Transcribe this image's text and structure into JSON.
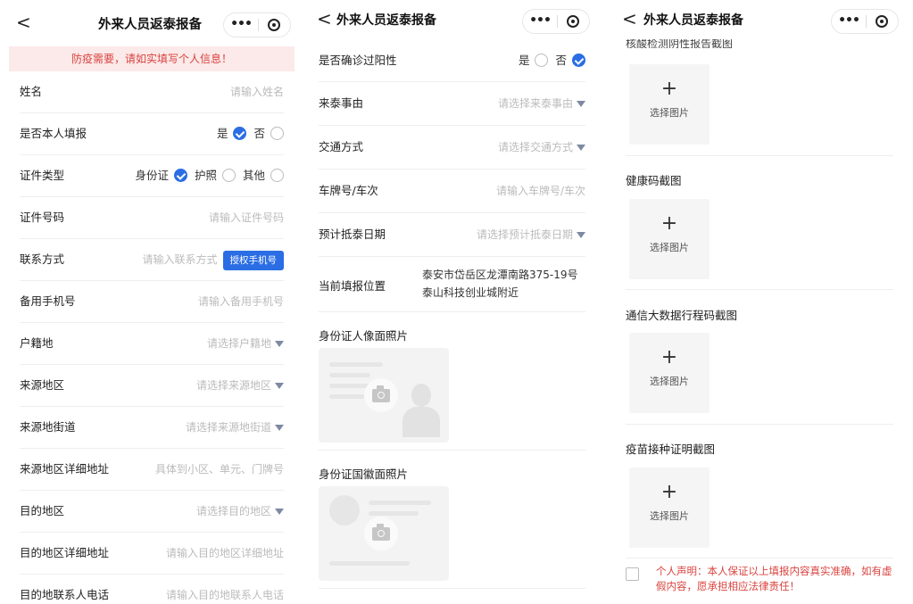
{
  "screen1": {
    "nav": {
      "back": "<",
      "title": "外来人员返泰报备",
      "dots": "•••"
    },
    "notice": "防疫需要，请如实填写个人信息！",
    "name": {
      "label": "姓名",
      "placeholder": "请输入姓名"
    },
    "self": {
      "label": "是否本人填报",
      "yes": "是",
      "no": "否",
      "selected": "yes"
    },
    "idtype": {
      "label": "证件类型",
      "opt1": "身份证",
      "opt2": "护照",
      "opt3": "其他",
      "selected": "身份证"
    },
    "idno": {
      "label": "证件号码",
      "placeholder": "请输入证件号码"
    },
    "contact": {
      "label": "联系方式",
      "placeholder": "请输入联系方式",
      "button": "授权手机号"
    },
    "backup": {
      "label": "备用手机号",
      "placeholder": "请输入备用手机号"
    },
    "huji": {
      "label": "户籍地",
      "placeholder": "请选择户籍地"
    },
    "origin": {
      "label": "来源地区",
      "placeholder": "请选择来源地区"
    },
    "street": {
      "label": "来源地街道",
      "placeholder": "请选择来源地街道"
    },
    "originaddr": {
      "label": "来源地区详细地址",
      "placeholder": "具体到小区、单元、门牌号"
    },
    "dest": {
      "label": "目的地区",
      "placeholder": "请选择目的地区"
    },
    "destaddr": {
      "label": "目的地区详细地址",
      "placeholder": "请输入目的地区详细地址"
    },
    "destphone": {
      "label": "目的地联系人电话",
      "placeholder": "请输入目的地联系人电话"
    }
  },
  "screen2": {
    "nav": {
      "back": "<",
      "title": "外来人员返泰报备",
      "dots": "•••"
    },
    "positive": {
      "label": "是否确诊过阳性",
      "yes": "是",
      "no": "否",
      "selected": "no"
    },
    "reason": {
      "label": "来泰事由",
      "placeholder": "请选择来泰事由"
    },
    "transport": {
      "label": "交通方式",
      "placeholder": "请选择交通方式"
    },
    "plate": {
      "label": "车牌号/车次",
      "placeholder": "请输入车牌号/车次"
    },
    "arrival": {
      "label": "预计抵泰日期",
      "placeholder": "请选择预计抵泰日期"
    },
    "location": {
      "label": "当前填报位置",
      "line1": "泰安市岱岳区龙潭南路375-19号",
      "line2": "泰山科技创业城附近"
    },
    "idfront": {
      "label": "身份证人像面照片"
    },
    "idback": {
      "label": "身份证国徽面照片"
    }
  },
  "screen3": {
    "nav": {
      "back": "<",
      "title": "外来人员返泰报备",
      "dots": "•••"
    },
    "cutoff_label": "核酸检测阴性报告截图",
    "upload_plus": "+",
    "upload_text": "选择图片",
    "health": "健康码截图",
    "travel": "通信大数据行程码截图",
    "vaccine": "疫苗接种证明截图",
    "declaration": "个人声明：本人保证以上填报内容真实准确，如有虚假内容，愿承担相应法律责任！"
  },
  "colors": {
    "accent": "#2a6de4",
    "warning": "#d9433f",
    "notice_bg": "#fce9e9"
  }
}
